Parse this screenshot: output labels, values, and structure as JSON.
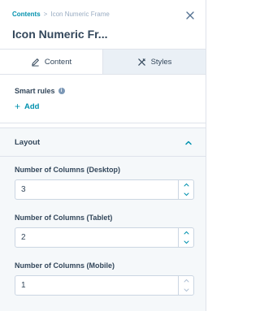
{
  "header": {
    "breadcrumb_link": "Contents",
    "breadcrumb_separator": ">",
    "breadcrumb_current": "Icon Numeric Frame",
    "title": "Icon Numeric Fr..."
  },
  "tabs": [
    {
      "label": "Content",
      "icon": "pencil-icon",
      "active": true
    },
    {
      "label": "Styles",
      "icon": "styles-icon",
      "active": false
    }
  ],
  "smart_rules": {
    "label": "Smart rules",
    "add_label": "Add"
  },
  "layout_section": {
    "title": "Layout",
    "fields": [
      {
        "label": "Number of Columns (Desktop)",
        "value": "3"
      },
      {
        "label": "Number of Columns (Tablet)",
        "value": "2"
      },
      {
        "label": "Number of Columns (Mobile)",
        "value": "1"
      }
    ]
  },
  "colors": {
    "accent": "#0091ae",
    "text": "#33475b",
    "border": "#dfe3eb",
    "section_bg": "#f5f8fa",
    "inactive_tab_bg": "#eaf0f6"
  }
}
